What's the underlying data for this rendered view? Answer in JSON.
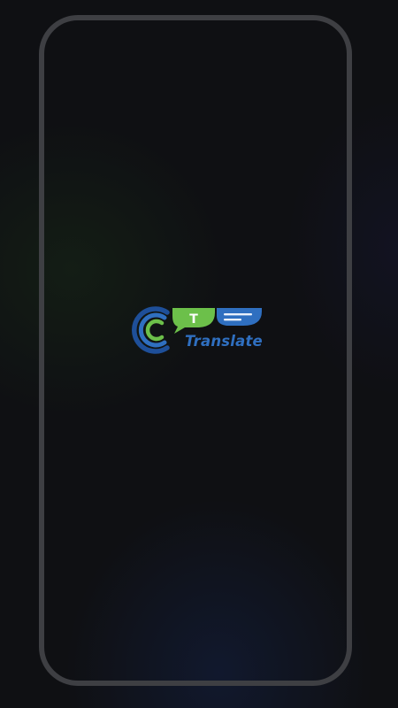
{
  "app": {
    "logo_wordmark": "Translate",
    "logo_badge_letter": "T",
    "colors": {
      "background": "#0f1013",
      "frame": "#3e3f43",
      "brand_green": "#6cc04a",
      "brand_blue": "#2f6fc0",
      "brand_dark_blue": "#1e4f99",
      "wordmark": "#2f6fc0"
    },
    "icons": [
      "circular-c-logo-icon",
      "speech-bubble-t-icon",
      "speech-bubble-lines-icon"
    ]
  }
}
